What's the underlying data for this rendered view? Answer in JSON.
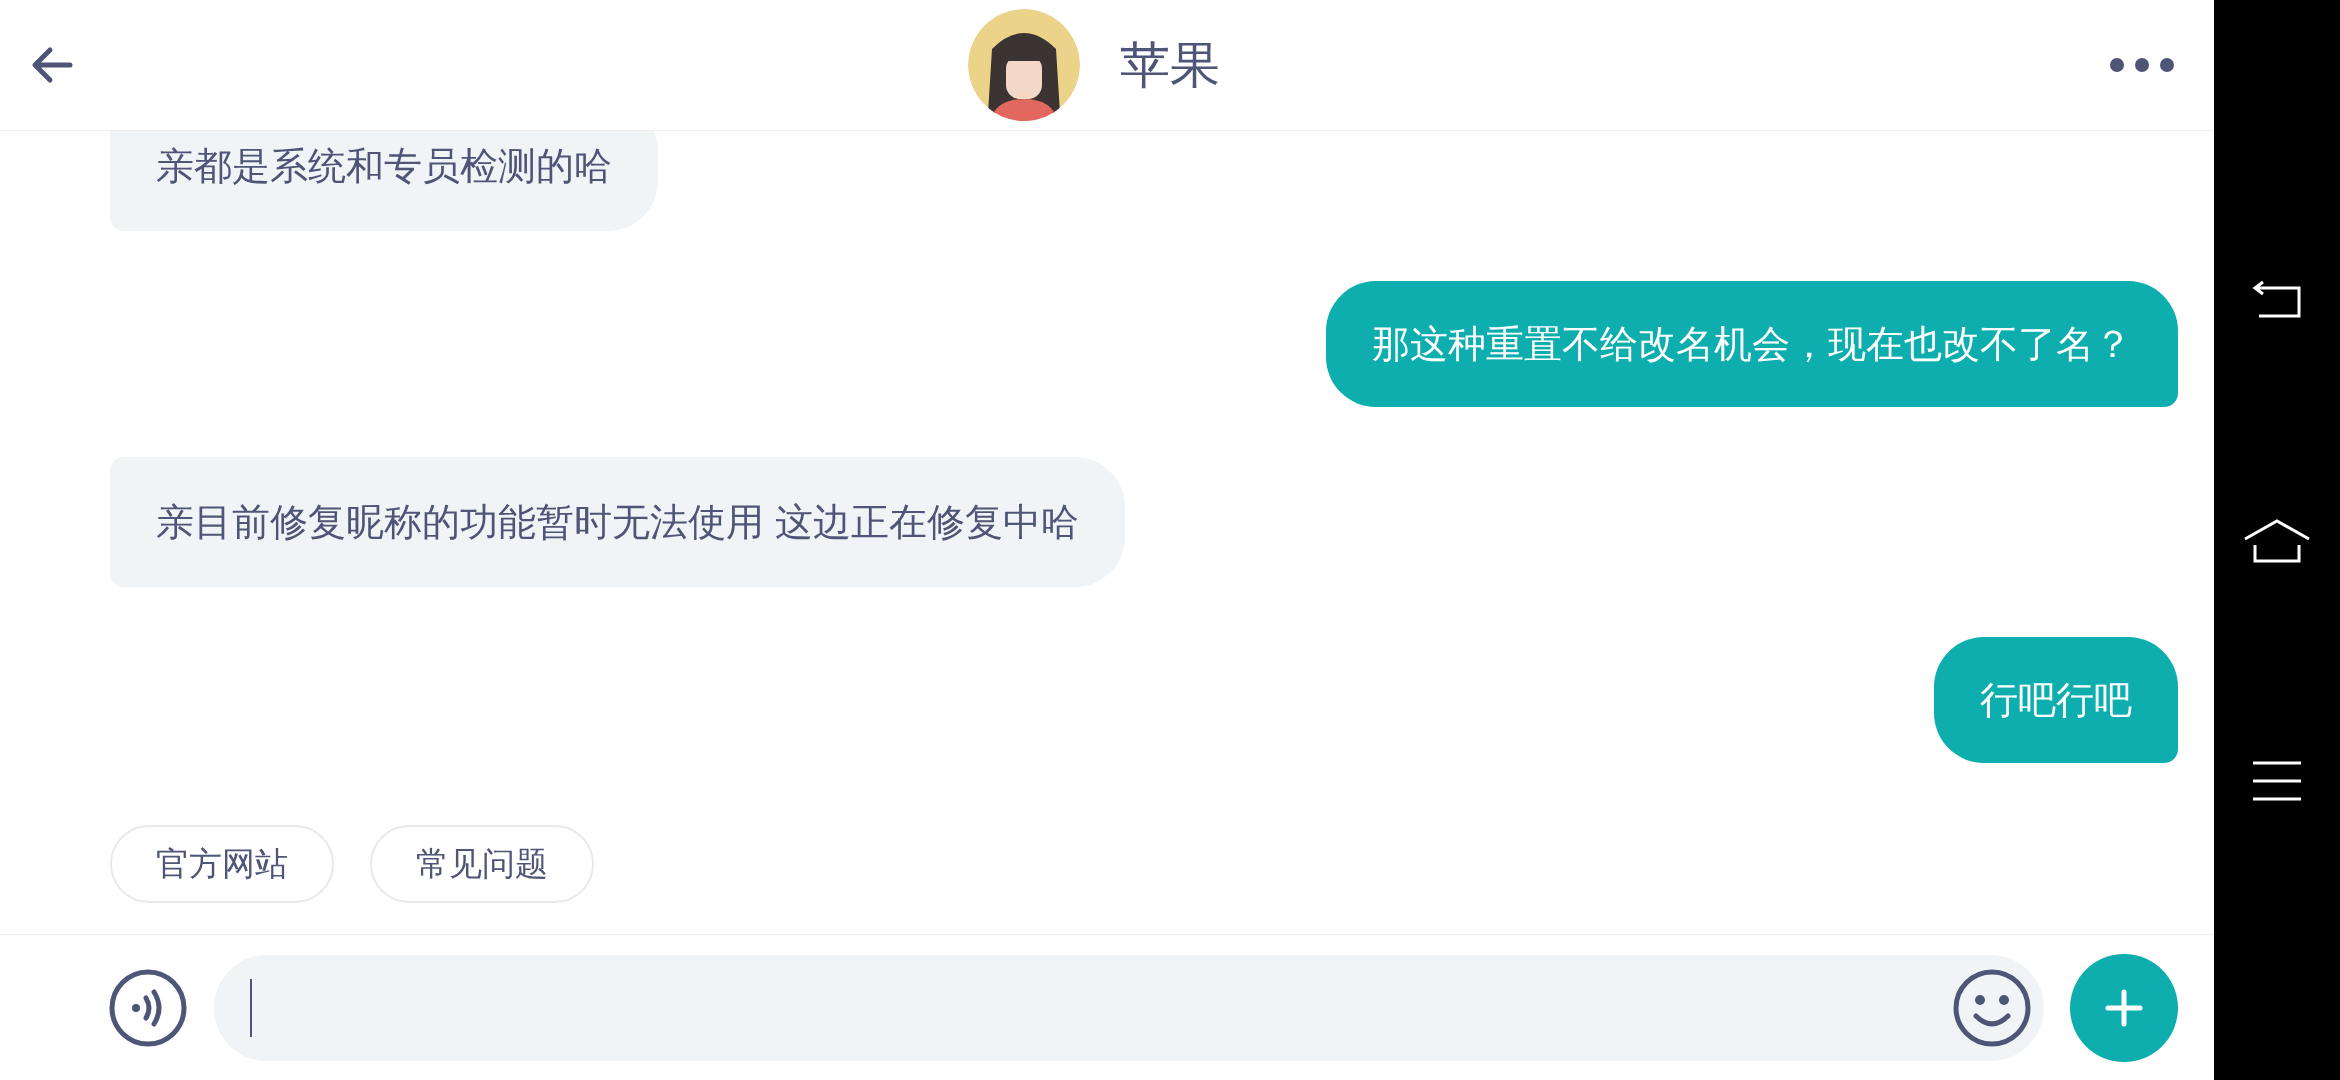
{
  "header": {
    "title": "苹果"
  },
  "messages": [
    {
      "kind": "incoming",
      "text": "亲都是系统和专员检测的哈"
    },
    {
      "kind": "outgoing",
      "text": "那这种重置不给改名机会，现在也改不了名？"
    },
    {
      "kind": "incoming",
      "text": "亲目前修复昵称的功能暂时无法使用 这边正在修复中哈"
    },
    {
      "kind": "outgoing",
      "text": "行吧行吧"
    }
  ],
  "quick_replies": [
    "官方网站",
    "常见问题"
  ]
}
